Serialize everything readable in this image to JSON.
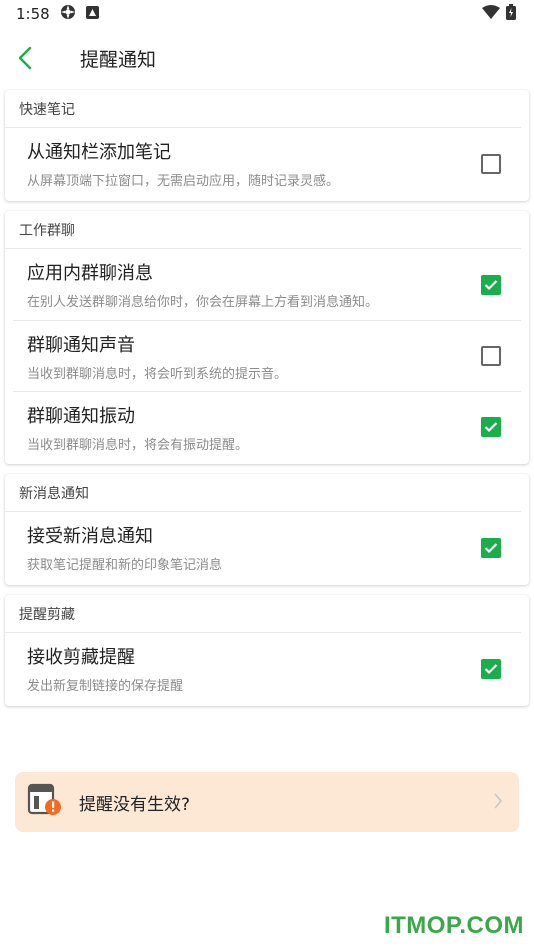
{
  "status": {
    "time": "1:58"
  },
  "header": {
    "title": "提醒通知"
  },
  "sections": [
    {
      "header": "快速笔记",
      "items": [
        {
          "title": "从通知栏添加笔记",
          "subtitle": "从屏幕顶端下拉窗口，无需启动应用，随时记录灵感。",
          "checked": false
        }
      ]
    },
    {
      "header": "工作群聊",
      "items": [
        {
          "title": "应用内群聊消息",
          "subtitle": "在别人发送群聊消息给你时，你会在屏幕上方看到消息通知。",
          "checked": true
        },
        {
          "title": "群聊通知声音",
          "subtitle": "当收到群聊消息时，将会听到系统的提示音。",
          "checked": false
        },
        {
          "title": "群聊通知振动",
          "subtitle": "当收到群聊消息时，将会有振动提醒。",
          "checked": true
        }
      ]
    },
    {
      "header": "新消息通知",
      "items": [
        {
          "title": "接受新消息通知",
          "subtitle": "获取笔记提醒和新的印象笔记消息",
          "checked": true
        }
      ]
    },
    {
      "header": "提醒剪藏",
      "items": [
        {
          "title": "接收剪藏提醒",
          "subtitle": "发出新复制链接的保存提醒",
          "checked": true
        }
      ]
    }
  ],
  "help": {
    "label": "提醒没有生效?"
  },
  "watermark": "ITMOP.COM",
  "colors": {
    "accent": "#1aad4b",
    "help_bg": "#fde8d6",
    "warning": "#f26b21"
  }
}
